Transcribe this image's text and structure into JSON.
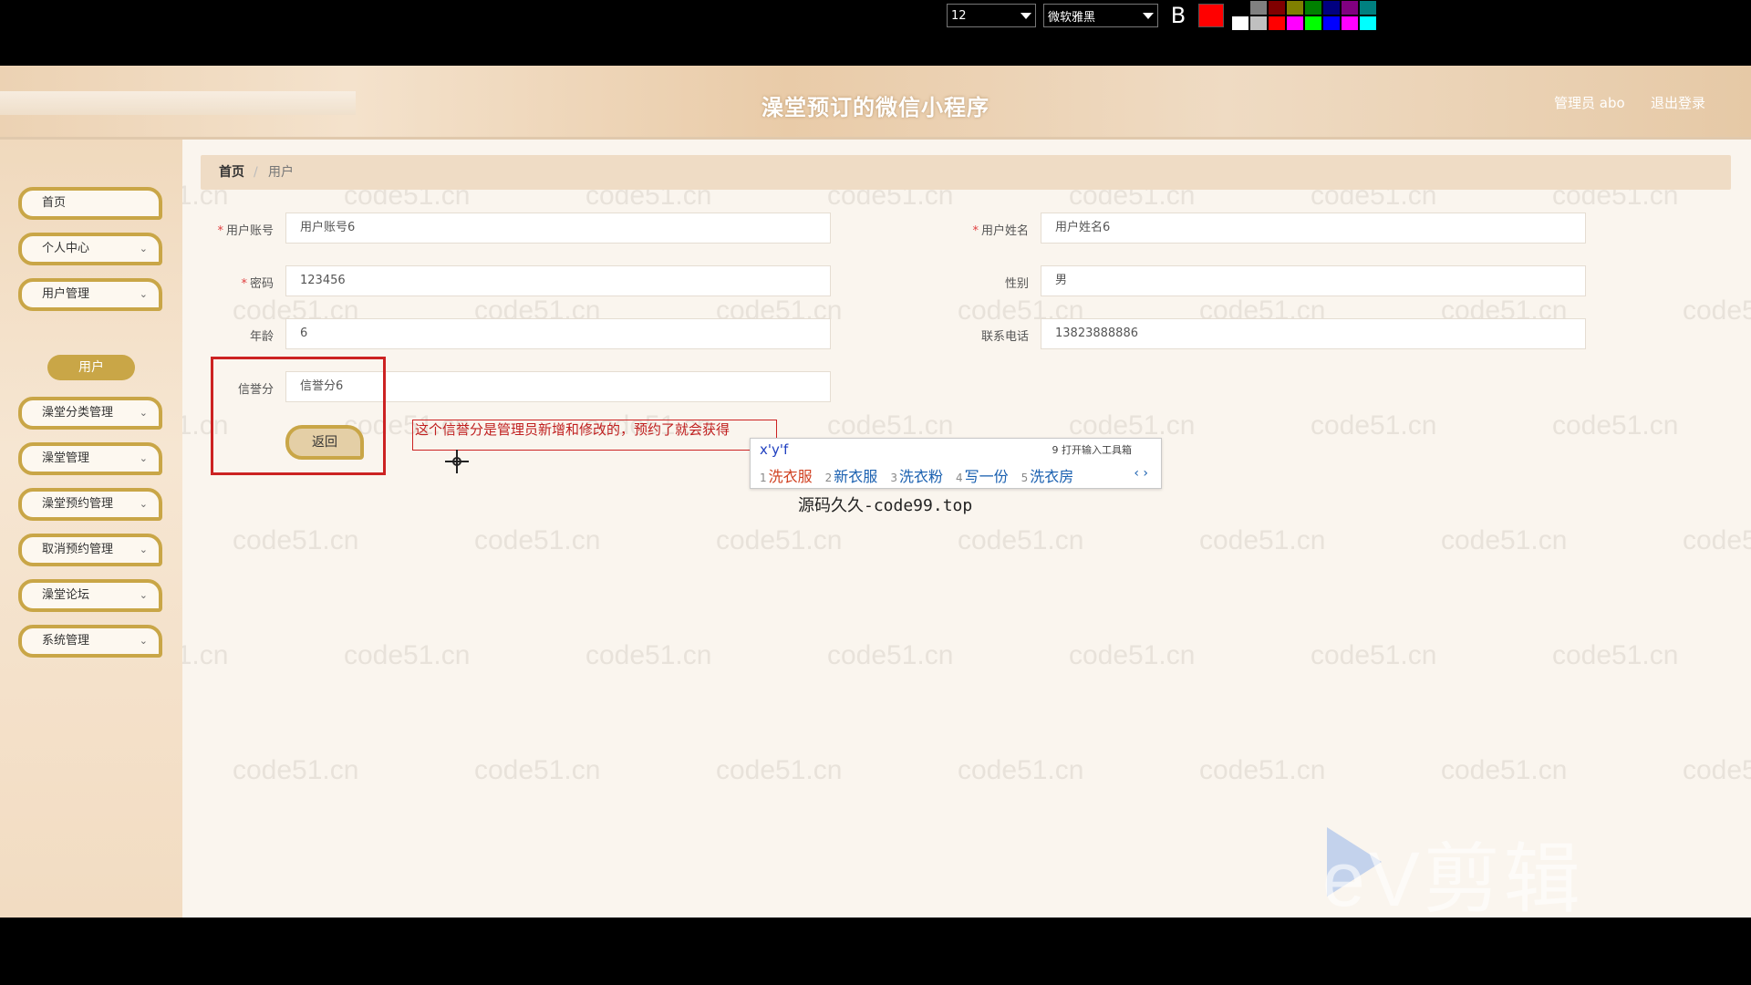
{
  "header": {
    "app_title": "澡堂预订的微信小程序",
    "admin_user": "管理员 abo",
    "logout": "退出登录"
  },
  "toolbar": {
    "font_size": "12",
    "font_family": "微软雅黑",
    "bold": "B",
    "current_color": "#ff0000",
    "palette": [
      "#000000",
      "#808080",
      "#800000",
      "#808000",
      "#008000",
      "#000080",
      "#800080",
      "#008080",
      "#ffffff",
      "#c0c0c0",
      "#ff0000",
      "#ff00ff",
      "#00ff00",
      "#0000ff",
      "#ff00ff",
      "#00ffff"
    ]
  },
  "sidebar": {
    "items": [
      {
        "label": "首页",
        "chevron": ""
      },
      {
        "label": "个人中心",
        "chevron": "⌄"
      },
      {
        "label": "用户管理",
        "chevron": "⌄"
      },
      {
        "label": "澡堂分类管理",
        "chevron": "⌄"
      },
      {
        "label": "澡堂管理",
        "chevron": "⌄"
      },
      {
        "label": "澡堂预约管理",
        "chevron": "⌄"
      },
      {
        "label": "取消预约管理",
        "chevron": "⌄"
      },
      {
        "label": "澡堂论坛",
        "chevron": "⌄"
      },
      {
        "label": "系统管理",
        "chevron": "⌄"
      }
    ],
    "sub_item": "用户"
  },
  "breadcrumb": {
    "home": "首页",
    "separator": "/",
    "current": "用户"
  },
  "form": {
    "account_label": "用户账号",
    "account_value": "用户账号6",
    "name_label": "用户姓名",
    "name_value": "用户姓名6",
    "password_label": "密码",
    "password_value": "123456",
    "gender_label": "性别",
    "gender_value": "男",
    "age_label": "年龄",
    "age_value": "6",
    "phone_label": "联系电话",
    "phone_value": "13823888886",
    "credit_label": "信誉分",
    "credit_value": "信誉分6",
    "required_mark": "*",
    "back_button": "返回"
  },
  "annotation": {
    "note": "这个信誉分是管理员新增和修改的，预约了就会获得"
  },
  "ime": {
    "input": "x'y'f",
    "tool": "9 打开输入工具箱",
    "candidates": [
      {
        "n": "1",
        "text": "洗衣服"
      },
      {
        "n": "2",
        "text": "新衣服"
      },
      {
        "n": "3",
        "text": "洗衣粉"
      },
      {
        "n": "4",
        "text": "写一份"
      },
      {
        "n": "5",
        "text": "洗衣房"
      }
    ],
    "next": "‹ ›"
  },
  "source_credit": "源码久久-code99.top",
  "watermark": "code51.cn",
  "ev_watermark": "eV剪辑"
}
